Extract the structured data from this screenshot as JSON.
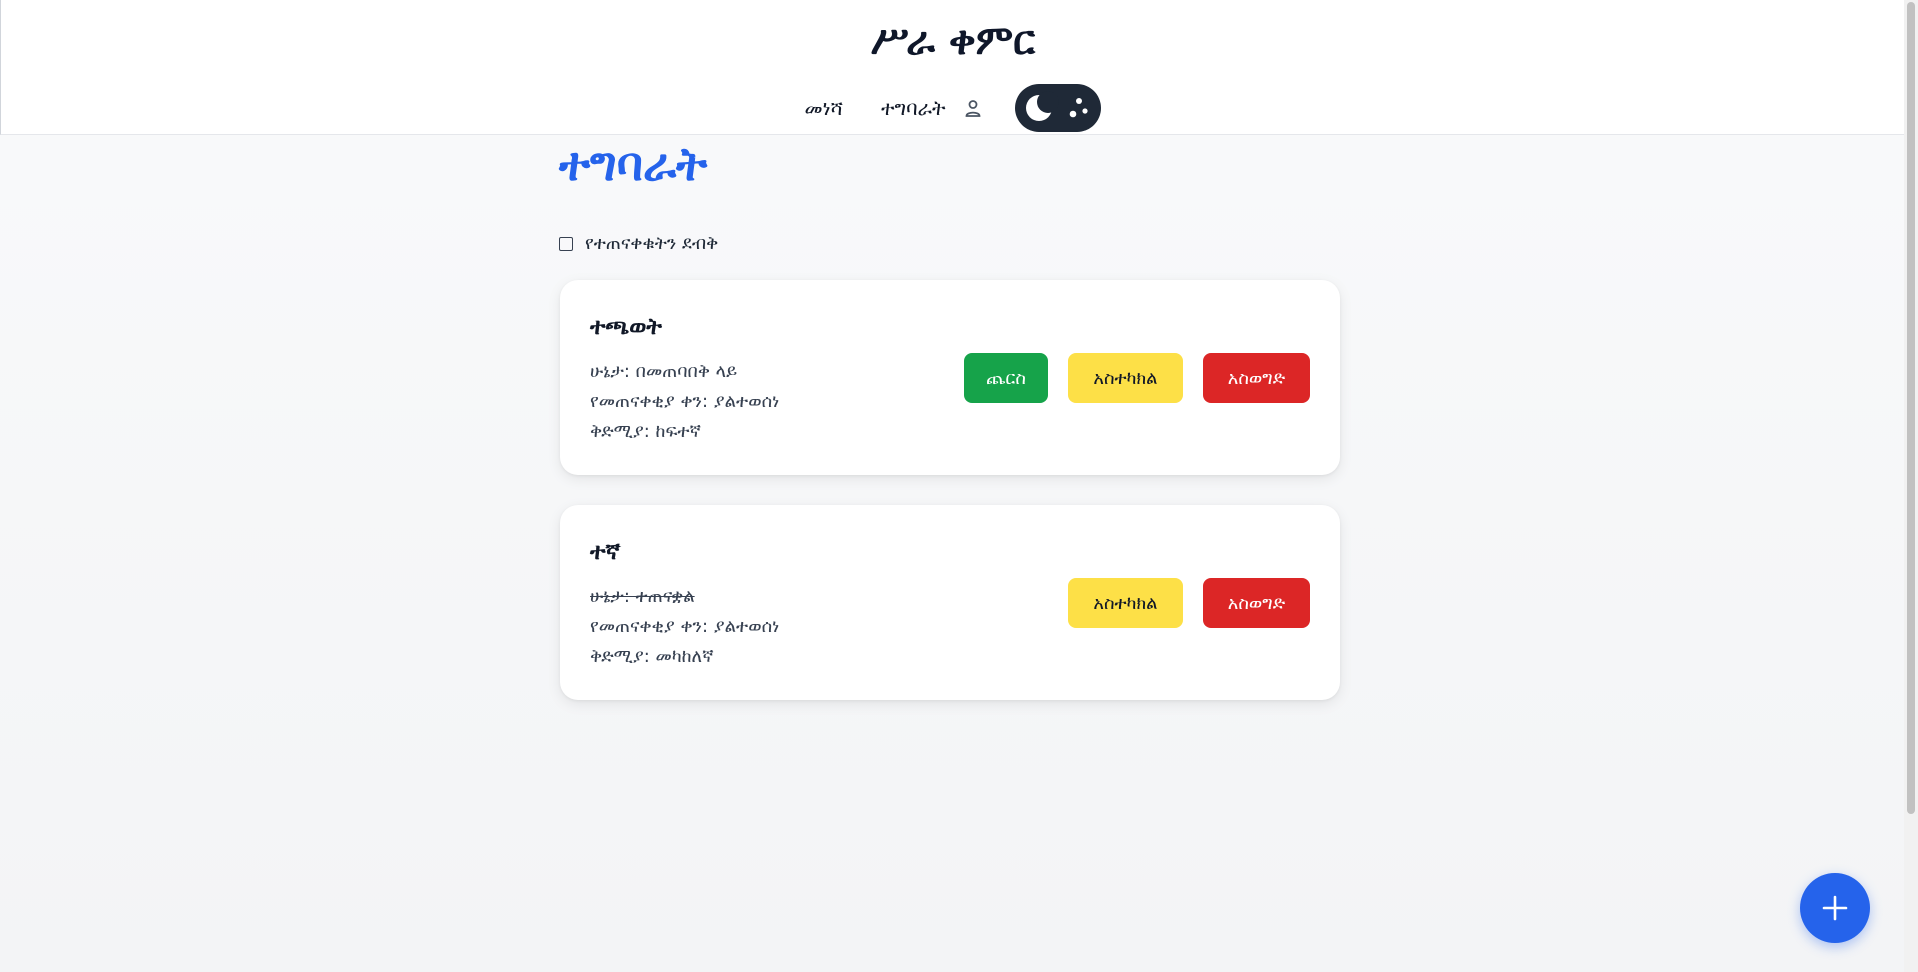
{
  "header": {
    "app_title": "ሥራ ቀምር",
    "nav": {
      "home_label": "መነሻ",
      "tasks_label": "ተግባራት"
    }
  },
  "main": {
    "page_title": "ተግባራት",
    "filter_label": "የተጠናቀቁትን ደብቅ",
    "tasks": [
      {
        "title": "ተጫወት",
        "status": "ሁኔታ: በመጠባበቅ ላይ",
        "due": "የመጠናቀቂያ ቀን: ያልተወሰነ",
        "priority": "ቅድሚያ: ከፍተኛ",
        "completed": false,
        "complete_label": "ጨርስ",
        "edit_label": "አስተካክል",
        "delete_label": "አስወግድ"
      },
      {
        "title": "ተኛ",
        "status": "ሁኔታ: ተጠናቋል",
        "due": "የመጠናቀቂያ ቀን: ያልተወሰነ",
        "priority": "ቅድሚያ: መካከለኛ",
        "completed": true,
        "edit_label": "አስተካክል",
        "delete_label": "አስወግድ"
      }
    ]
  },
  "colors": {
    "accent": "#2563eb",
    "complete_button": "#16a34a",
    "edit_button": "#fde047",
    "delete_button": "#dc2626"
  },
  "icons": {
    "user": "user-icon",
    "theme": "moon-icon",
    "add": "plus-icon"
  }
}
